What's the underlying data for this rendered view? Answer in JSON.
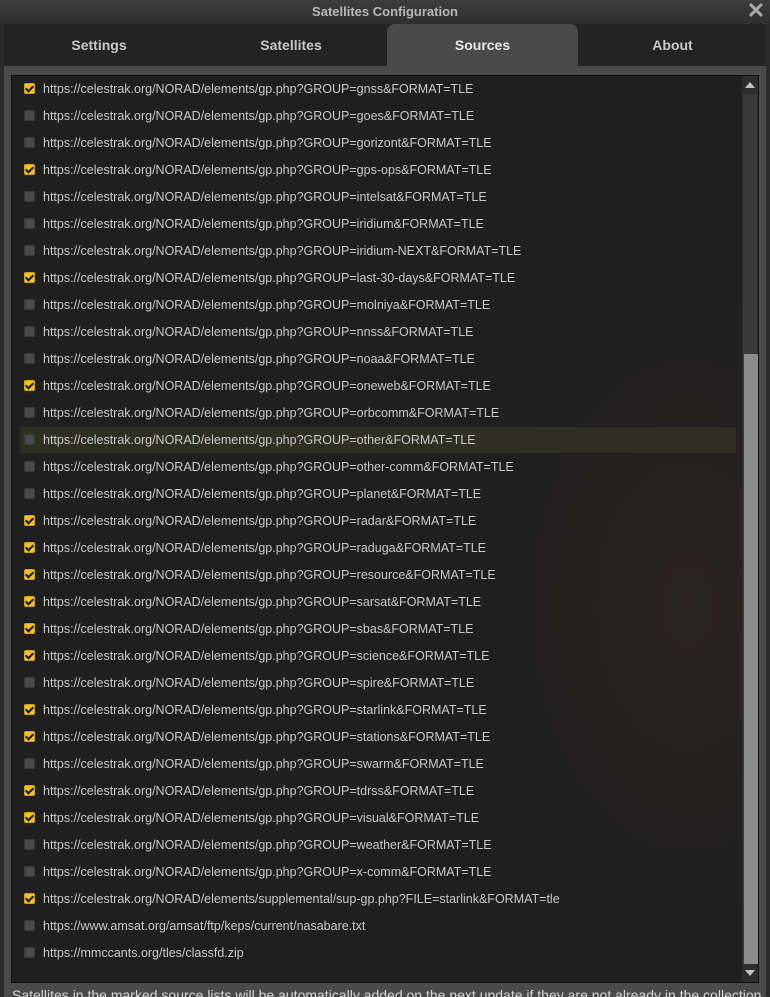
{
  "window": {
    "title": "Satellites Configuration"
  },
  "tabs": [
    {
      "label": "Settings",
      "active": false
    },
    {
      "label": "Satellites",
      "active": false
    },
    {
      "label": "Sources",
      "active": true
    },
    {
      "label": "About",
      "active": false
    }
  ],
  "sources": [
    {
      "url": "https://celestrak.org/NORAD/elements/gp.php?GROUP=gnss&FORMAT=TLE",
      "checked": true
    },
    {
      "url": "https://celestrak.org/NORAD/elements/gp.php?GROUP=goes&FORMAT=TLE",
      "checked": false
    },
    {
      "url": "https://celestrak.org/NORAD/elements/gp.php?GROUP=gorizont&FORMAT=TLE",
      "checked": false
    },
    {
      "url": "https://celestrak.org/NORAD/elements/gp.php?GROUP=gps-ops&FORMAT=TLE",
      "checked": true
    },
    {
      "url": "https://celestrak.org/NORAD/elements/gp.php?GROUP=intelsat&FORMAT=TLE",
      "checked": false
    },
    {
      "url": "https://celestrak.org/NORAD/elements/gp.php?GROUP=iridium&FORMAT=TLE",
      "checked": false
    },
    {
      "url": "https://celestrak.org/NORAD/elements/gp.php?GROUP=iridium-NEXT&FORMAT=TLE",
      "checked": false
    },
    {
      "url": "https://celestrak.org/NORAD/elements/gp.php?GROUP=last-30-days&FORMAT=TLE",
      "checked": true
    },
    {
      "url": "https://celestrak.org/NORAD/elements/gp.php?GROUP=molniya&FORMAT=TLE",
      "checked": false
    },
    {
      "url": "https://celestrak.org/NORAD/elements/gp.php?GROUP=nnss&FORMAT=TLE",
      "checked": false
    },
    {
      "url": "https://celestrak.org/NORAD/elements/gp.php?GROUP=noaa&FORMAT=TLE",
      "checked": false
    },
    {
      "url": "https://celestrak.org/NORAD/elements/gp.php?GROUP=oneweb&FORMAT=TLE",
      "checked": true
    },
    {
      "url": "https://celestrak.org/NORAD/elements/gp.php?GROUP=orbcomm&FORMAT=TLE",
      "checked": false
    },
    {
      "url": "https://celestrak.org/NORAD/elements/gp.php?GROUP=other&FORMAT=TLE",
      "checked": false,
      "highlighted": true
    },
    {
      "url": "https://celestrak.org/NORAD/elements/gp.php?GROUP=other-comm&FORMAT=TLE",
      "checked": false
    },
    {
      "url": "https://celestrak.org/NORAD/elements/gp.php?GROUP=planet&FORMAT=TLE",
      "checked": false
    },
    {
      "url": "https://celestrak.org/NORAD/elements/gp.php?GROUP=radar&FORMAT=TLE",
      "checked": true
    },
    {
      "url": "https://celestrak.org/NORAD/elements/gp.php?GROUP=raduga&FORMAT=TLE",
      "checked": true
    },
    {
      "url": "https://celestrak.org/NORAD/elements/gp.php?GROUP=resource&FORMAT=TLE",
      "checked": true
    },
    {
      "url": "https://celestrak.org/NORAD/elements/gp.php?GROUP=sarsat&FORMAT=TLE",
      "checked": true
    },
    {
      "url": "https://celestrak.org/NORAD/elements/gp.php?GROUP=sbas&FORMAT=TLE",
      "checked": true
    },
    {
      "url": "https://celestrak.org/NORAD/elements/gp.php?GROUP=science&FORMAT=TLE",
      "checked": true
    },
    {
      "url": "https://celestrak.org/NORAD/elements/gp.php?GROUP=spire&FORMAT=TLE",
      "checked": false
    },
    {
      "url": "https://celestrak.org/NORAD/elements/gp.php?GROUP=starlink&FORMAT=TLE",
      "checked": true
    },
    {
      "url": "https://celestrak.org/NORAD/elements/gp.php?GROUP=stations&FORMAT=TLE",
      "checked": true
    },
    {
      "url": "https://celestrak.org/NORAD/elements/gp.php?GROUP=swarm&FORMAT=TLE",
      "checked": false
    },
    {
      "url": "https://celestrak.org/NORAD/elements/gp.php?GROUP=tdrss&FORMAT=TLE",
      "checked": true
    },
    {
      "url": "https://celestrak.org/NORAD/elements/gp.php?GROUP=visual&FORMAT=TLE",
      "checked": true
    },
    {
      "url": "https://celestrak.org/NORAD/elements/gp.php?GROUP=weather&FORMAT=TLE",
      "checked": false
    },
    {
      "url": "https://celestrak.org/NORAD/elements/gp.php?GROUP=x-comm&FORMAT=TLE",
      "checked": false
    },
    {
      "url": "https://celestrak.org/NORAD/elements/supplemental/sup-gp.php?FILE=starlink&FORMAT=tle",
      "checked": true
    },
    {
      "url": "https://www.amsat.org/amsat/ftp/keps/current/nasabare.txt",
      "checked": false
    },
    {
      "url": "https://mmccants.org/tles/classfd.zip",
      "checked": false
    }
  ],
  "status_text": "Satellites in the marked source lists will be automatically added on the next update if they are not already in the collection.",
  "colors": {
    "checkbox_checked": "#f1c12b",
    "row_highlight": "#2f2e22",
    "tab_active": "#4a4a4a"
  },
  "icons": {
    "close": "close-icon",
    "scroll_up": "scroll-up-icon",
    "scroll_down": "scroll-down-icon"
  }
}
